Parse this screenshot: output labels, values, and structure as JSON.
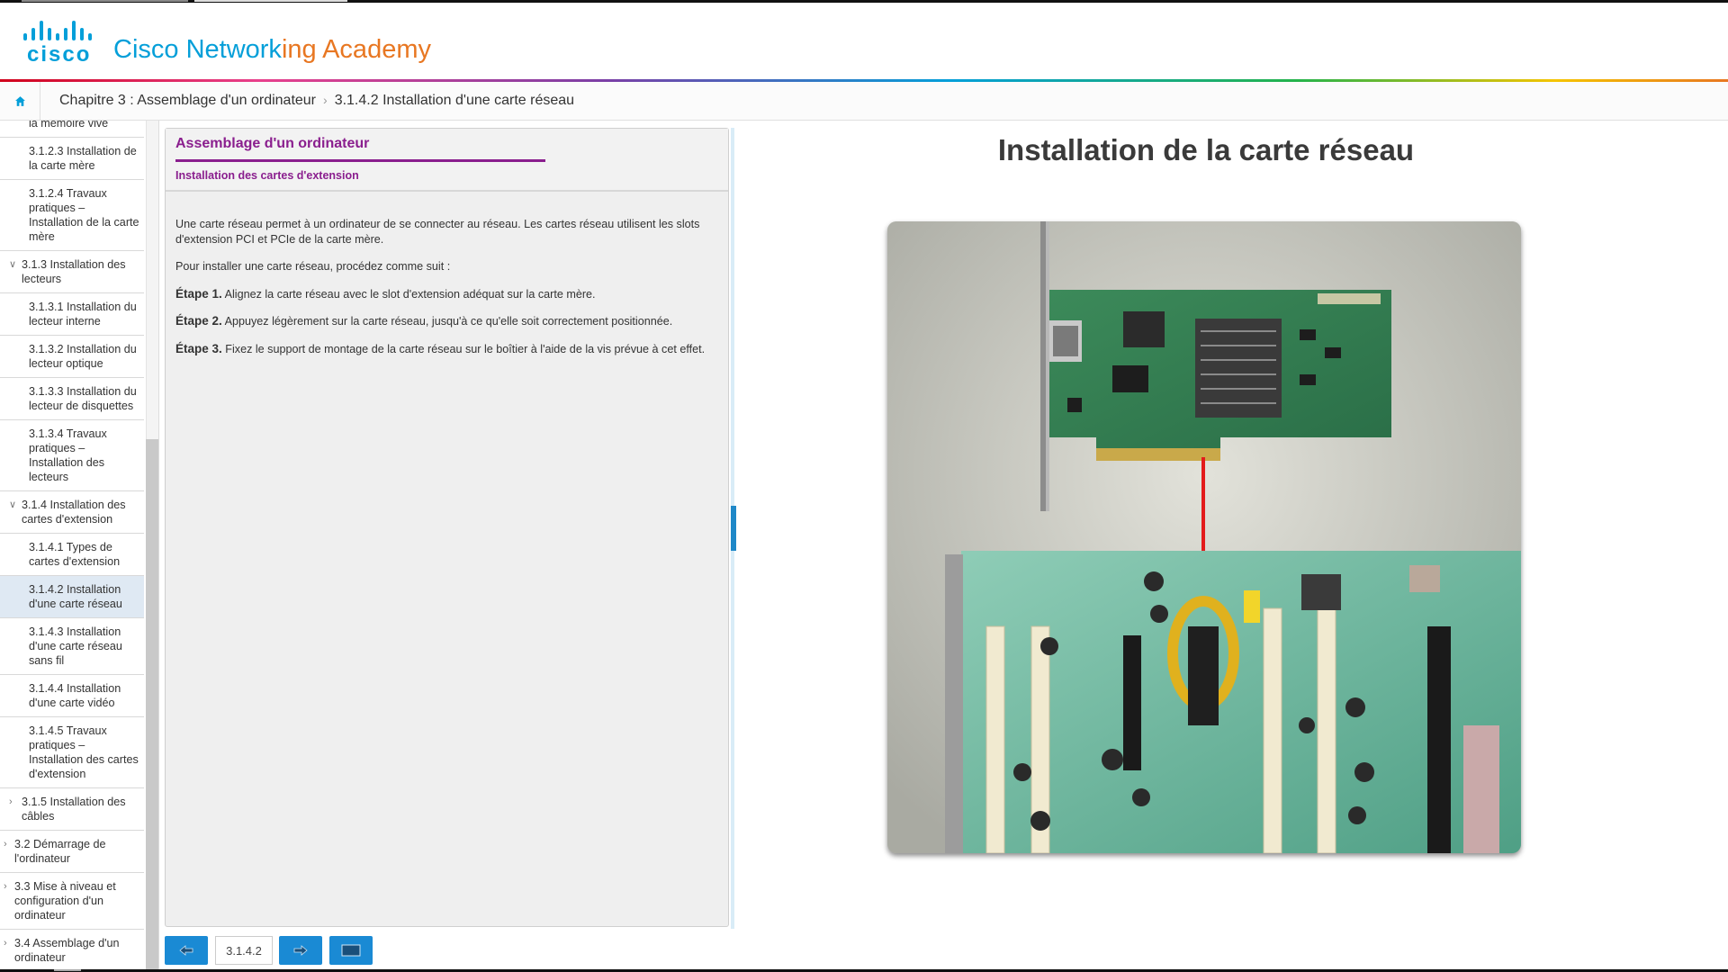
{
  "header": {
    "logo_wordmark": "cisco",
    "academy_part1": "Cisco Network",
    "academy_part2": "ing Academy"
  },
  "breadcrumb": {
    "chapter": "Chapitre 3 : Assemblage d'un ordinateur",
    "current": "3.1.4.2 Installation d'une carte réseau"
  },
  "icons": {
    "home": "home-icon",
    "prev": "arrow-left-icon",
    "next": "arrow-right-icon",
    "fullscreen": "screen-icon"
  },
  "sidebar": {
    "items": [
      {
        "label": "la mémoire vive",
        "level": 4
      },
      {
        "label": "3.1.2.3 Installation de la carte mère",
        "level": 4
      },
      {
        "label": "3.1.2.4 Travaux pratiques – Installation de la carte mère",
        "level": 4
      },
      {
        "label": "3.1.3 Installation des lecteurs",
        "level": 3,
        "chevron": "down"
      },
      {
        "label": "3.1.3.1 Installation du lecteur interne",
        "level": 4
      },
      {
        "label": "3.1.3.2 Installation du lecteur optique",
        "level": 4
      },
      {
        "label": "3.1.3.3 Installation du lecteur de disquettes",
        "level": 4
      },
      {
        "label": "3.1.3.4 Travaux pratiques – Installation des lecteurs",
        "level": 4
      },
      {
        "label": "3.1.4 Installation des cartes d'extension",
        "level": 3,
        "chevron": "down"
      },
      {
        "label": "3.1.4.1 Types de cartes d'extension",
        "level": 4
      },
      {
        "label": "3.1.4.2 Installation d'une carte réseau",
        "level": 4,
        "active": true
      },
      {
        "label": "3.1.4.3 Installation d'une carte réseau sans fil",
        "level": 4
      },
      {
        "label": "3.1.4.4 Installation d'une carte vidéo",
        "level": 4
      },
      {
        "label": "3.1.4.5 Travaux pratiques – Installation des cartes d'extension",
        "level": 4
      },
      {
        "label": "3.1.5 Installation des câbles",
        "level": 3,
        "chevron": "right"
      },
      {
        "label": "3.2 Démarrage de l'ordinateur",
        "level": 2,
        "chevron": "right"
      },
      {
        "label": "3.3 Mise à niveau et configuration d'un ordinateur",
        "level": 2,
        "chevron": "right"
      },
      {
        "label": "3.4 Assemblage d'un ordinateur",
        "level": 2,
        "chevron": "right"
      }
    ]
  },
  "panel": {
    "title": "Assemblage d'un ordinateur",
    "subtitle": "Installation des cartes d'extension",
    "intro": "Une carte réseau permet à un ordinateur de se connecter au réseau. Les cartes réseau utilisent les slots d'extension PCI et PCIe de la carte mère.",
    "lead": "Pour installer une carte réseau, procédez comme suit :",
    "steps": [
      {
        "label": "Étape 1.",
        "text": " Alignez la carte réseau avec le slot d'extension adéquat sur la carte mère."
      },
      {
        "label": "Étape 2.",
        "text": " Appuyez légèrement sur la carte réseau, jusqu'à ce qu'elle soit correctement positionnée."
      },
      {
        "label": "Étape 3.",
        "text": " Fixez le support de montage de la carte réseau sur le boîtier à l'aide de la vis prévue à cet effet."
      }
    ]
  },
  "footer": {
    "page_number": "3.1.4.2"
  },
  "slide": {
    "title": "Installation de la carte réseau"
  },
  "colors": {
    "cisco_blue": "#049fd9",
    "academy_orange": "#e87722",
    "heading_purple": "#8a1e8e",
    "button_blue": "#1a8ad4",
    "active_row": "#dfe9f3",
    "arrow_red": "#e31b1b"
  }
}
